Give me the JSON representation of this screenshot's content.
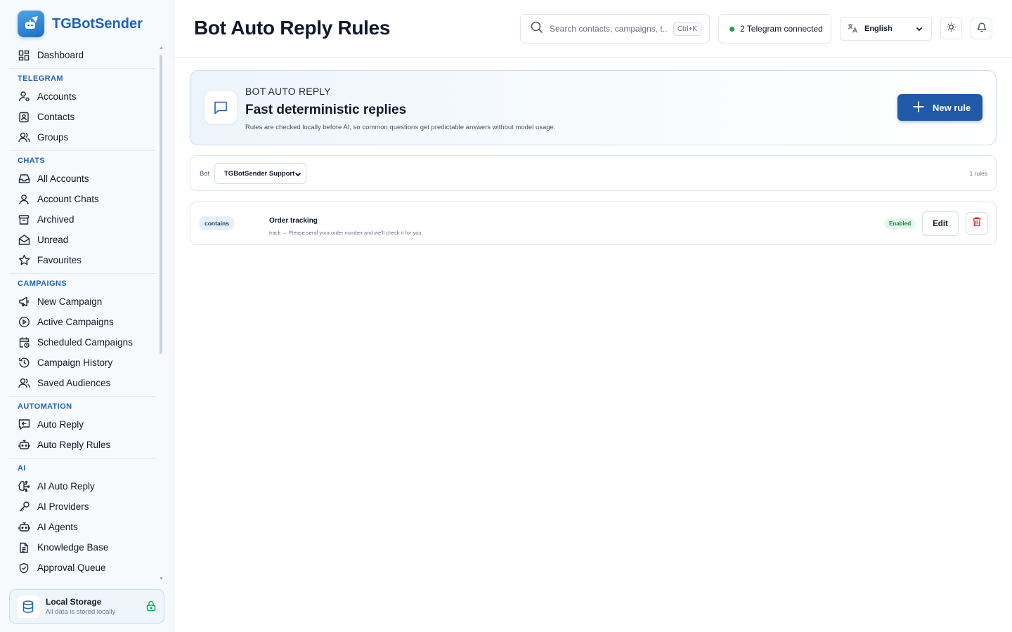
{
  "app": {
    "name": "TGBotSender"
  },
  "sidebar": {
    "dashboard": "Dashboard",
    "sections": {
      "telegram": "TELEGRAM",
      "chats": "CHATS",
      "campaigns": "CAMPAIGNS",
      "automation": "AUTOMATION",
      "ai": "AI"
    },
    "items": {
      "accounts": "Accounts",
      "contacts": "Contacts",
      "groups": "Groups",
      "all_accounts": "All Accounts",
      "account_chats": "Account Chats",
      "archived": "Archived",
      "unread": "Unread",
      "favourites": "Favourites",
      "new_campaign": "New Campaign",
      "active_campaigns": "Active Campaigns",
      "scheduled_campaigns": "Scheduled Campaigns",
      "campaign_history": "Campaign History",
      "saved_audiences": "Saved Audiences",
      "auto_reply": "Auto Reply",
      "auto_reply_rules": "Auto Reply Rules",
      "ai_auto_reply": "AI Auto Reply",
      "ai_providers": "AI Providers",
      "ai_agents": "AI Agents",
      "knowledge_base": "Knowledge Base",
      "approval_queue": "Approval Queue"
    },
    "storage": {
      "title": "Local Storage",
      "subtitle": "All data is stored locally"
    }
  },
  "header": {
    "title": "Bot Auto Reply Rules",
    "search_placeholder": "Search contacts, campaigns, t...",
    "search_shortcut": "Ctrl+K",
    "connection_status": "2 Telegram connected",
    "language": "English"
  },
  "hero": {
    "kicker": "BOT AUTO REPLY",
    "title": "Fast deterministic replies",
    "description": "Rules are checked locally before AI, so common questions get predictable answers without model usage.",
    "new_rule_label": "New rule"
  },
  "filter": {
    "bot_label": "Bot",
    "bot_selected": "TGBotSender Support",
    "rules_count": "1 rules"
  },
  "rules": [
    {
      "match_type": "contains",
      "name": "Order tracking",
      "summary": "track → Please send your order number and we'll check it for you.",
      "status": "Enabled",
      "edit_label": "Edit"
    }
  ],
  "colors": {
    "brand": "#1e63b7",
    "primary_button": "#1f59a8",
    "status_green": "#16a34a",
    "delete_red": "#dc2626"
  }
}
